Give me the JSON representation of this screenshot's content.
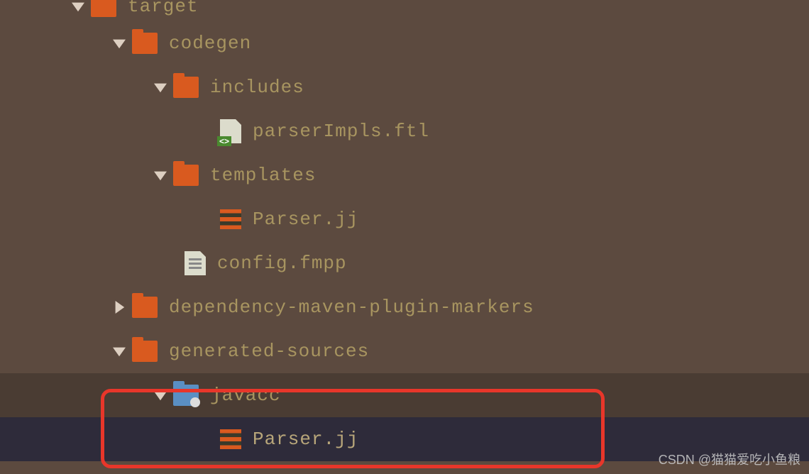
{
  "tree": {
    "target": {
      "label": "target"
    },
    "codegen": {
      "label": "codegen"
    },
    "includes": {
      "label": "includes"
    },
    "parserImpls": {
      "label": "parserImpls.ftl"
    },
    "templates": {
      "label": "templates"
    },
    "parserJj1": {
      "label": "Parser.jj"
    },
    "configFmpp": {
      "label": "config.fmpp"
    },
    "dependencyMarkers": {
      "label": "dependency-maven-plugin-markers"
    },
    "generatedSources": {
      "label": "generated-sources"
    },
    "javacc": {
      "label": "javacc"
    },
    "parserJj2": {
      "label": "Parser.jj"
    }
  },
  "watermark": "CSDN @猫猫爱吃小鱼粮"
}
